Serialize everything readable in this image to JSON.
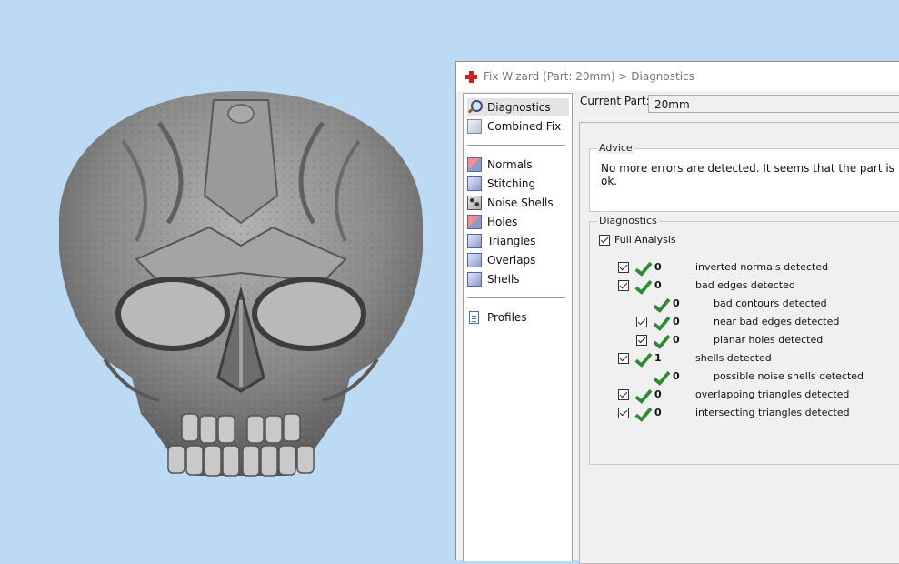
{
  "window": {
    "title": "Fix Wizard (Part: 20mm) > Diagnostics"
  },
  "sidebar": {
    "items": [
      {
        "label": "Diagnostics",
        "icon": "magnifier-icon",
        "selected": true
      },
      {
        "label": "Combined Fix",
        "icon": "cube-icon"
      },
      {
        "label": "Normals",
        "icon": "cube-red-icon"
      },
      {
        "label": "Stitching",
        "icon": "cube-icon"
      },
      {
        "label": "Noise Shells",
        "icon": "dotted-cube-icon"
      },
      {
        "label": "Holes",
        "icon": "cube-red-icon"
      },
      {
        "label": "Triangles",
        "icon": "cube-icon"
      },
      {
        "label": "Overlaps",
        "icon": "cube-icon"
      },
      {
        "label": "Shells",
        "icon": "cube-icon"
      },
      {
        "label": "Profiles",
        "icon": "document-icon"
      }
    ]
  },
  "current_part": {
    "label": "Current Part:",
    "value": "20mm"
  },
  "advice": {
    "title": "Advice",
    "text": "No more errors are detected. It seems that the part is ok."
  },
  "diagnostics": {
    "title": "Diagnostics",
    "full_analysis": {
      "label": "Full Analysis",
      "checked": true
    },
    "rows": [
      {
        "count": "0",
        "label": "inverted normals detected"
      },
      {
        "count": "0",
        "label": "bad edges detected"
      },
      {
        "count": "0",
        "label": "bad contours detected"
      },
      {
        "count": "0",
        "label": "near bad edges detected"
      },
      {
        "count": "0",
        "label": "planar holes detected"
      },
      {
        "count": "1",
        "label": "shells detected"
      },
      {
        "count": "0",
        "label": "possible noise shells detected"
      },
      {
        "count": "0",
        "label": "overlapping triangles detected"
      },
      {
        "count": "0",
        "label": "intersecting triangles detected"
      }
    ]
  },
  "colors": {
    "viewport_bg": "#bcdaf3",
    "check_green": "#2f8a32",
    "title_cross": "#d01f1f"
  }
}
